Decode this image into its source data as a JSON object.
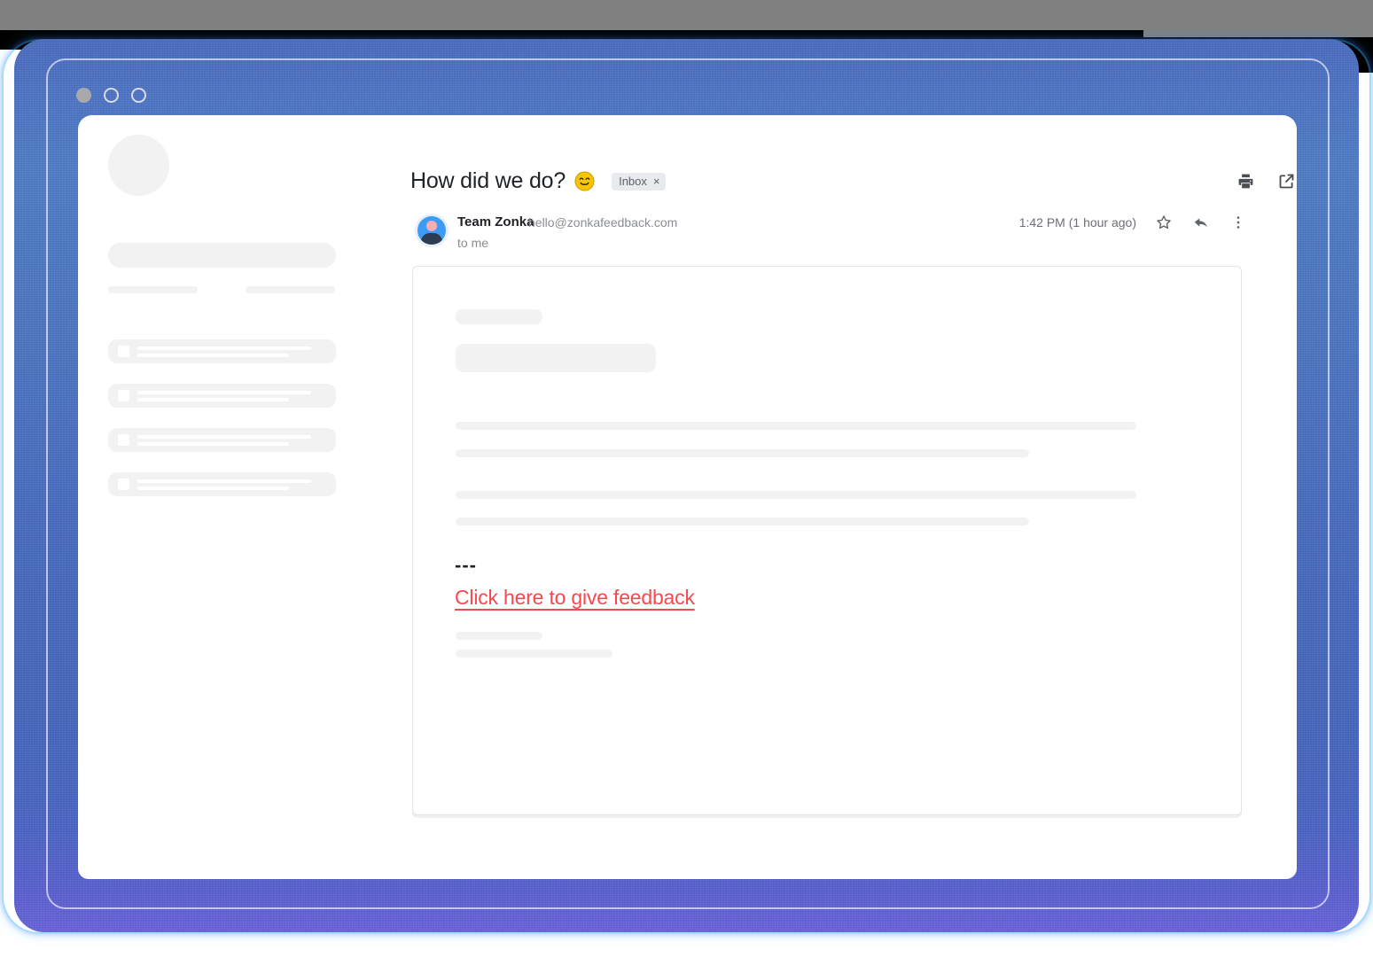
{
  "window": {
    "dots": [
      "window-dot-close",
      "window-dot-minimize",
      "window-dot-maximize"
    ]
  },
  "sidebar": {
    "skeleton": {
      "avatar": "profile-avatar-placeholder",
      "search_bar": "search-bar-placeholder",
      "sub_labels": [
        "label-placeholder-1",
        "label-placeholder-2"
      ],
      "rows": [
        {
          "name": "mail-list-item-placeholder-1"
        },
        {
          "name": "mail-list-item-placeholder-2"
        },
        {
          "name": "mail-list-item-placeholder-3"
        },
        {
          "name": "mail-list-item-placeholder-4"
        }
      ]
    }
  },
  "mail": {
    "subject": "How did we do?",
    "subject_emoji": "smiling-face-with-smiling-eyes",
    "label": {
      "text": "Inbox",
      "remove": "×"
    },
    "header_actions": [
      {
        "name": "print-icon",
        "label": "Print"
      },
      {
        "name": "open-in-new-window-icon",
        "label": "Open in new window"
      }
    ],
    "sender": {
      "name": "Team Zonka",
      "email": "hello@zonkafeedback.com",
      "recipient": "to me",
      "avatar": "sender-avatar"
    },
    "timestamp": "1:42 PM (1 hour ago)",
    "message_actions": [
      {
        "name": "star-icon",
        "label": "Star"
      },
      {
        "name": "reply-icon",
        "label": "Reply"
      },
      {
        "name": "more-options-icon",
        "label": "More"
      }
    ],
    "body": {
      "separator": "---",
      "cta_link": "Click here to give feedback",
      "placeholders": [
        "greeting-placeholder",
        "intro-box-placeholder",
        "paragraph-line-1",
        "paragraph-line-2",
        "paragraph-line-3",
        "paragraph-line-4",
        "signature-line-1",
        "signature-line-2"
      ]
    }
  },
  "colors": {
    "frame_blue": "#4a6bc0",
    "link_red": "#f8484f",
    "skeleton_grey": "#f2f2f3",
    "chip_grey": "#e8eaed",
    "avatar_blue": "#3d9bf5"
  }
}
